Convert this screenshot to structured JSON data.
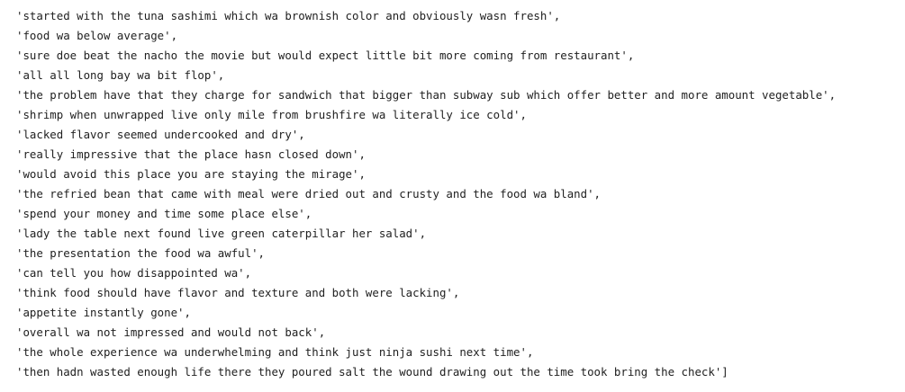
{
  "output": {
    "lines": [
      "'started with the tuna sashimi which wa brownish color and obviously wasn fresh',",
      "'food wa below average',",
      "'sure doe beat the nacho the movie but would expect little bit more coming from restaurant',",
      "'all all long bay wa bit flop',",
      "'the problem have that they charge for sandwich that bigger than subway sub which offer better and more amount vegetable',",
      "'shrimp when unwrapped live only mile from brushfire wa literally ice cold',",
      "'lacked flavor seemed undercooked and dry',",
      "'really impressive that the place hasn closed down',",
      "'would avoid this place you are staying the mirage',",
      "'the refried bean that came with meal were dried out and crusty and the food wa bland',",
      "'spend your money and time some place else',",
      "'lady the table next found live green caterpillar her salad',",
      "'the presentation the food wa awful',",
      "'can tell you how disappointed wa',",
      "'think food should have flavor and texture and both were lacking',",
      "'appetite instantly gone',",
      "'overall wa not impressed and would not back',",
      "'the whole experience wa underwhelming and think just ninja sushi next time',",
      "'then hadn wasted enough life there they poured salt the wound drawing out the time took bring the check']"
    ]
  }
}
